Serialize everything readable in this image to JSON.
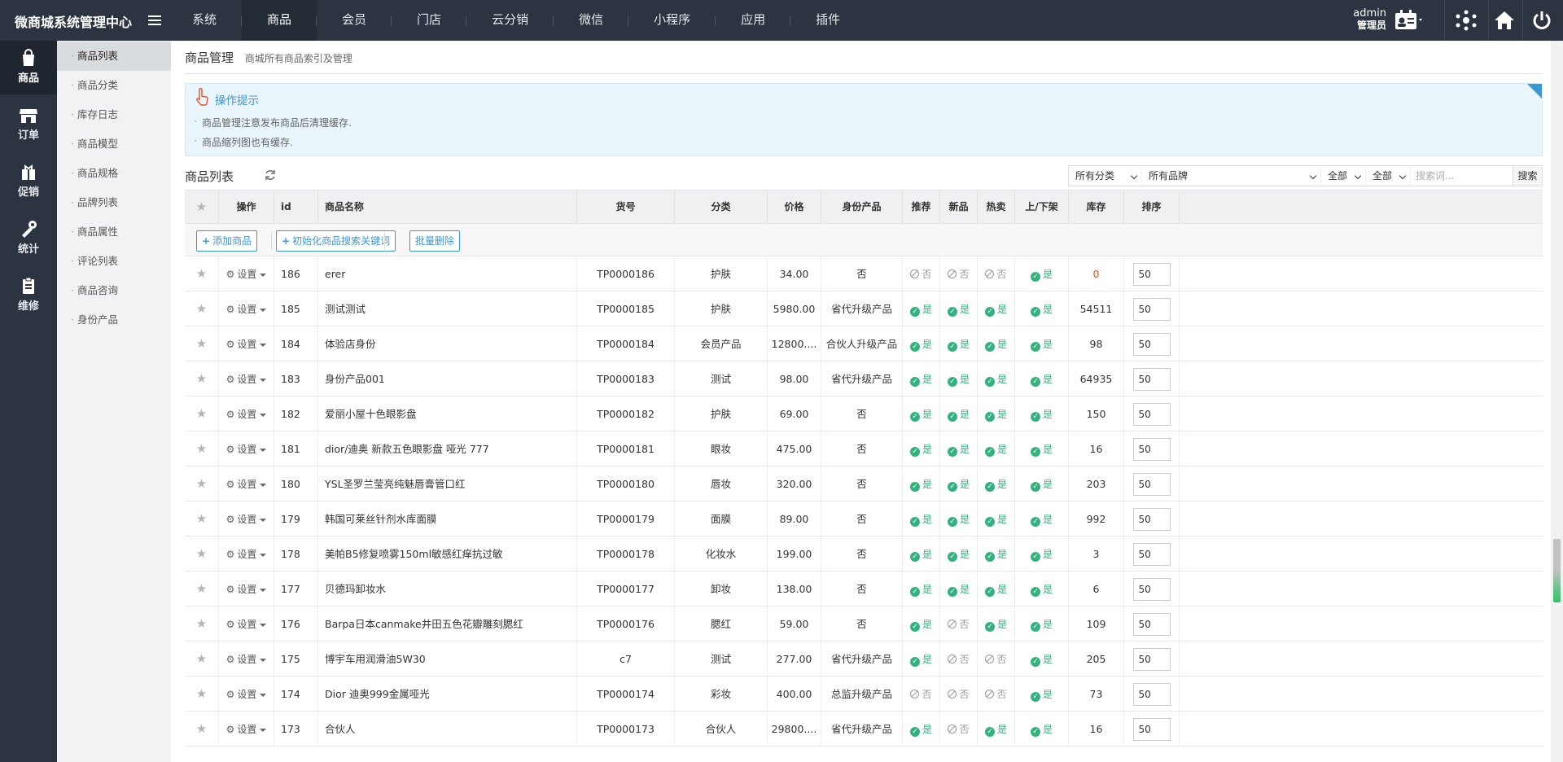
{
  "app": {
    "title": "微商城系统管理中心"
  },
  "topnav": [
    "系统",
    "商品",
    "会员",
    "门店",
    "云分销",
    "微信",
    "小程序",
    "应用",
    "插件"
  ],
  "user": {
    "name": "admin",
    "role": "管理员"
  },
  "iconbar": [
    "商品",
    "订单",
    "促销",
    "统计",
    "维修"
  ],
  "submenu": [
    "商品列表",
    "商品分类",
    "库存日志",
    "商品模型",
    "商品规格",
    "品牌列表",
    "商品属性",
    "评论列表",
    "商品咨询",
    "身份产品"
  ],
  "page": {
    "title": "商品管理",
    "subtitle": "商城所有商品索引及管理"
  },
  "tips": {
    "title": "操作提示",
    "lines": [
      "商品管理注意发布商品后清理缓存.",
      "商品缩列图也有缓存."
    ]
  },
  "list": {
    "title": "商品列表"
  },
  "filters": {
    "category": "所有分类",
    "brand": "所有品牌",
    "f1": "全部",
    "f2": "全部",
    "search_placeholder": "搜索词...",
    "search_button": "搜索"
  },
  "columns": [
    "操作",
    "id",
    "商品名称",
    "货号",
    "分类",
    "价格",
    "身份产品",
    "推荐",
    "新品",
    "热卖",
    "上/下架",
    "库存",
    "排序"
  ],
  "toolbar": {
    "add": "添加商品",
    "init": "初始化商品搜索关键词",
    "batch_delete": "批量删除"
  },
  "labels": {
    "setting": "设置",
    "yes": "是",
    "no": "否"
  },
  "rows": [
    {
      "id": "186",
      "name": "erer",
      "sku": "TP0000186",
      "cat": "护肤",
      "price": "34.00",
      "identity": "否",
      "rec": false,
      "new": false,
      "hot": false,
      "onsale": true,
      "stock": "0",
      "sort": "50"
    },
    {
      "id": "185",
      "name": "测试测试",
      "sku": "TP0000185",
      "cat": "护肤",
      "price": "5980.00",
      "identity": "省代升级产品",
      "rec": true,
      "new": true,
      "hot": true,
      "onsale": true,
      "stock": "54511",
      "sort": "50"
    },
    {
      "id": "184",
      "name": "体验店身份",
      "sku": "TP0000184",
      "cat": "会员产品",
      "price": "12800....",
      "identity": "合伙人升级产品",
      "rec": true,
      "new": true,
      "hot": true,
      "onsale": true,
      "stock": "98",
      "sort": "50"
    },
    {
      "id": "183",
      "name": "身份产品001",
      "sku": "TP0000183",
      "cat": "测试",
      "price": "98.00",
      "identity": "省代升级产品",
      "rec": true,
      "new": true,
      "hot": true,
      "onsale": true,
      "stock": "64935",
      "sort": "50"
    },
    {
      "id": "182",
      "name": "爱丽小屋十色眼影盘",
      "sku": "TP0000182",
      "cat": "护肤",
      "price": "69.00",
      "identity": "否",
      "rec": true,
      "new": true,
      "hot": true,
      "onsale": true,
      "stock": "150",
      "sort": "50"
    },
    {
      "id": "181",
      "name": "dior/迪奥 新款五色眼影盘 哑光 777",
      "sku": "TP0000181",
      "cat": "眼妆",
      "price": "475.00",
      "identity": "否",
      "rec": true,
      "new": true,
      "hot": true,
      "onsale": true,
      "stock": "16",
      "sort": "50"
    },
    {
      "id": "180",
      "name": "YSL圣罗兰莹亮纯魅唇膏管口红",
      "sku": "TP0000180",
      "cat": "唇妆",
      "price": "320.00",
      "identity": "否",
      "rec": true,
      "new": true,
      "hot": true,
      "onsale": true,
      "stock": "203",
      "sort": "50"
    },
    {
      "id": "179",
      "name": "韩国可莱丝针剂水库面膜",
      "sku": "TP0000179",
      "cat": "面膜",
      "price": "89.00",
      "identity": "否",
      "rec": true,
      "new": true,
      "hot": true,
      "onsale": true,
      "stock": "992",
      "sort": "50"
    },
    {
      "id": "178",
      "name": "美帕B5修复喷雾150ml敏感红痒抗过敏",
      "sku": "TP0000178",
      "cat": "化妆水",
      "price": "199.00",
      "identity": "否",
      "rec": true,
      "new": true,
      "hot": true,
      "onsale": true,
      "stock": "3",
      "sort": "50"
    },
    {
      "id": "177",
      "name": "贝德玛卸妆水",
      "sku": "TP0000177",
      "cat": "卸妆",
      "price": "138.00",
      "identity": "否",
      "rec": true,
      "new": true,
      "hot": true,
      "onsale": true,
      "stock": "6",
      "sort": "50"
    },
    {
      "id": "176",
      "name": "Barpa日本canmake井田五色花瓣雕刻腮红",
      "sku": "TP0000176",
      "cat": "腮红",
      "price": "59.00",
      "identity": "否",
      "rec": true,
      "new": false,
      "hot": true,
      "onsale": true,
      "stock": "109",
      "sort": "50"
    },
    {
      "id": "175",
      "name": "博宇车用润滑油5W30",
      "sku": "c7",
      "cat": "测试",
      "price": "277.00",
      "identity": "省代升级产品",
      "rec": true,
      "new": false,
      "hot": false,
      "onsale": true,
      "stock": "205",
      "sort": "50"
    },
    {
      "id": "174",
      "name": "Dior 迪奥999金属哑光",
      "sku": "TP0000174",
      "cat": "彩妆",
      "price": "400.00",
      "identity": "总监升级产品",
      "rec": false,
      "new": false,
      "hot": false,
      "onsale": true,
      "stock": "73",
      "sort": "50"
    },
    {
      "id": "173",
      "name": "合伙人",
      "sku": "TP0000173",
      "cat": "合伙人",
      "price": "29800....",
      "identity": "省代升级产品",
      "rec": true,
      "new": false,
      "hot": true,
      "onsale": true,
      "stock": "16",
      "sort": "50"
    }
  ],
  "colors": {
    "topbar": "#2b3440",
    "accent": "#3a97d6",
    "yes": "#32b27e",
    "stock_zero": "#e0522c"
  }
}
